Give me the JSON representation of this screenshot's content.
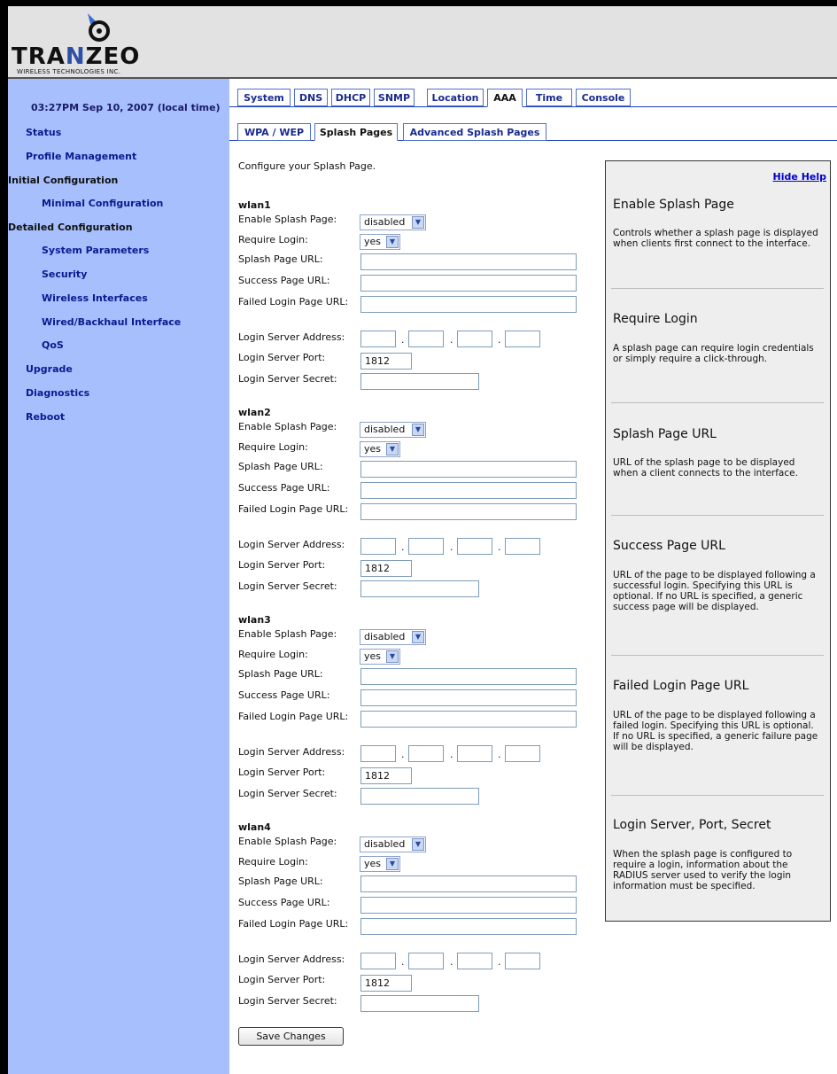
{
  "brand": {
    "name_part1": "TRA",
    "name_accent": "N",
    "name_part2": "ZEO",
    "tagline": "WIRELESS TECHNOLOGIES INC."
  },
  "sidebar": {
    "clock": "03:27PM Sep 10, 2007 (local time)",
    "items": [
      {
        "label": "Status"
      },
      {
        "label": "Profile Management"
      },
      {
        "label": "Initial Configuration"
      },
      {
        "label": "Minimal Configuration"
      },
      {
        "label": "Detailed Configuration"
      },
      {
        "label": "System Parameters"
      },
      {
        "label": "Security"
      },
      {
        "label": "Wireless Interfaces"
      },
      {
        "label": "Wired/Backhaul Interface"
      },
      {
        "label": "QoS"
      },
      {
        "label": "Upgrade"
      },
      {
        "label": "Diagnostics"
      },
      {
        "label": "Reboot"
      }
    ]
  },
  "top_tabs": [
    {
      "label": "System"
    },
    {
      "label": "DNS"
    },
    {
      "label": "DHCP"
    },
    {
      "label": "SNMP"
    },
    {
      "label": "Location"
    },
    {
      "label": "AAA",
      "active": true
    },
    {
      "label": "Time"
    },
    {
      "label": "Console"
    }
  ],
  "sub_tabs": [
    {
      "label": "WPA / WEP"
    },
    {
      "label": "Splash Pages",
      "active": true
    },
    {
      "label": "Advanced Splash Pages"
    }
  ],
  "intro": "Configure your Splash Page.",
  "labels": {
    "enable": "Enable Splash Page:",
    "require": "Require Login:",
    "splash_url": "Splash Page URL:",
    "success_url": "Success Page URL:",
    "failed_url": "Failed Login Page URL:",
    "server_addr": "Login Server Address:",
    "server_port": "Login Server Port:",
    "server_secret": "Login Server Secret:"
  },
  "interfaces": [
    {
      "name": "wlan1",
      "enable": "disabled",
      "require": "yes",
      "port": "1812"
    },
    {
      "name": "wlan2",
      "enable": "disabled",
      "require": "yes",
      "port": "1812"
    },
    {
      "name": "wlan3",
      "enable": "disabled",
      "require": "yes",
      "port": "1812"
    },
    {
      "name": "wlan4",
      "enable": "disabled",
      "require": "yes",
      "port": "1812"
    }
  ],
  "save_label": "Save Changes",
  "help": {
    "hide_label": "Hide Help",
    "sections": [
      {
        "title": "Enable Splash Page",
        "body": "Controls whether a splash page is displayed when clients first connect to the interface."
      },
      {
        "title": "Require Login",
        "body": "A splash page can require login credentials or simply require a click-through."
      },
      {
        "title": "Splash Page URL",
        "body": "URL of the splash page to be displayed when a client connects to the interface."
      },
      {
        "title": "Success Page URL",
        "body": "URL of the page to be displayed following a successful login. Specifying this URL is optional. If no URL is specified, a generic success page will be displayed."
      },
      {
        "title": "Failed Login Page URL",
        "body": "URL of the page to be displayed following a failed login. Specifying this URL is optional. If no URL is specified, a generic failure page will be displayed."
      },
      {
        "title": "Login Server, Port, Secret",
        "body": "When the splash page is configured to require a login, information about the RADIUS server used to verify the login information must be specified."
      }
    ]
  },
  "colors": {
    "sidebar_bg": "#a7bffd",
    "nav_link": "#0a1a8f",
    "tab_border": "#5070c8",
    "help_bg": "#eeeeee",
    "header_bg": "#e2e2e2"
  }
}
